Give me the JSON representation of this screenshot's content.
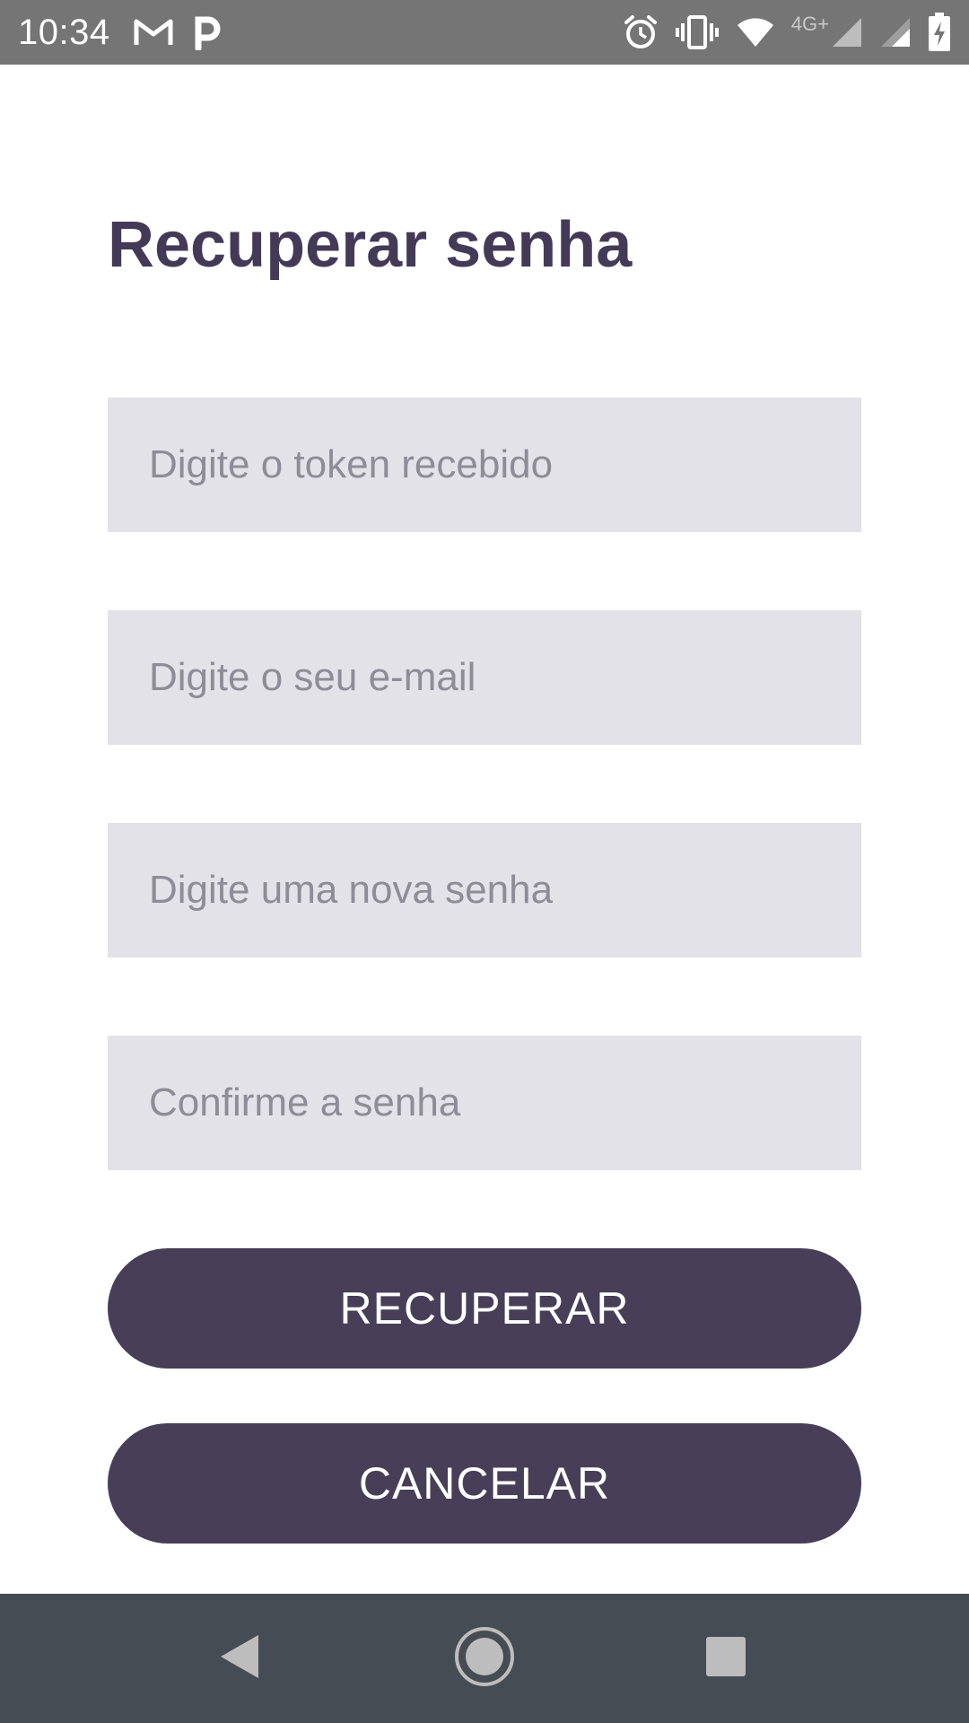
{
  "status_bar": {
    "time": "10:34",
    "network_label": "4G+",
    "icons": [
      "gmail-icon",
      "parking-app-icon",
      "alarm-icon",
      "vibrate-icon",
      "wifi-icon",
      "signal-icon",
      "signal-icon",
      "battery-charging-icon"
    ]
  },
  "page": {
    "title": "Recuperar senha"
  },
  "form": {
    "token_placeholder": "Digite o token recebido",
    "email_placeholder": "Digite o seu e-mail",
    "new_password_placeholder": "Digite uma nova senha",
    "confirm_password_placeholder": "Confirme a senha",
    "token_value": "",
    "email_value": "",
    "new_password_value": "",
    "confirm_password_value": ""
  },
  "actions": {
    "recover_label": "RECUPERAR",
    "cancel_label": "CANCELAR"
  },
  "nav_bar": {
    "icons": [
      "back-icon",
      "home-icon",
      "recents-icon"
    ]
  },
  "colors": {
    "primary": "#473e58",
    "title": "#433a57",
    "field_bg": "#e3e2e8",
    "status_bar": "#757575",
    "nav_bar": "#464c53"
  }
}
